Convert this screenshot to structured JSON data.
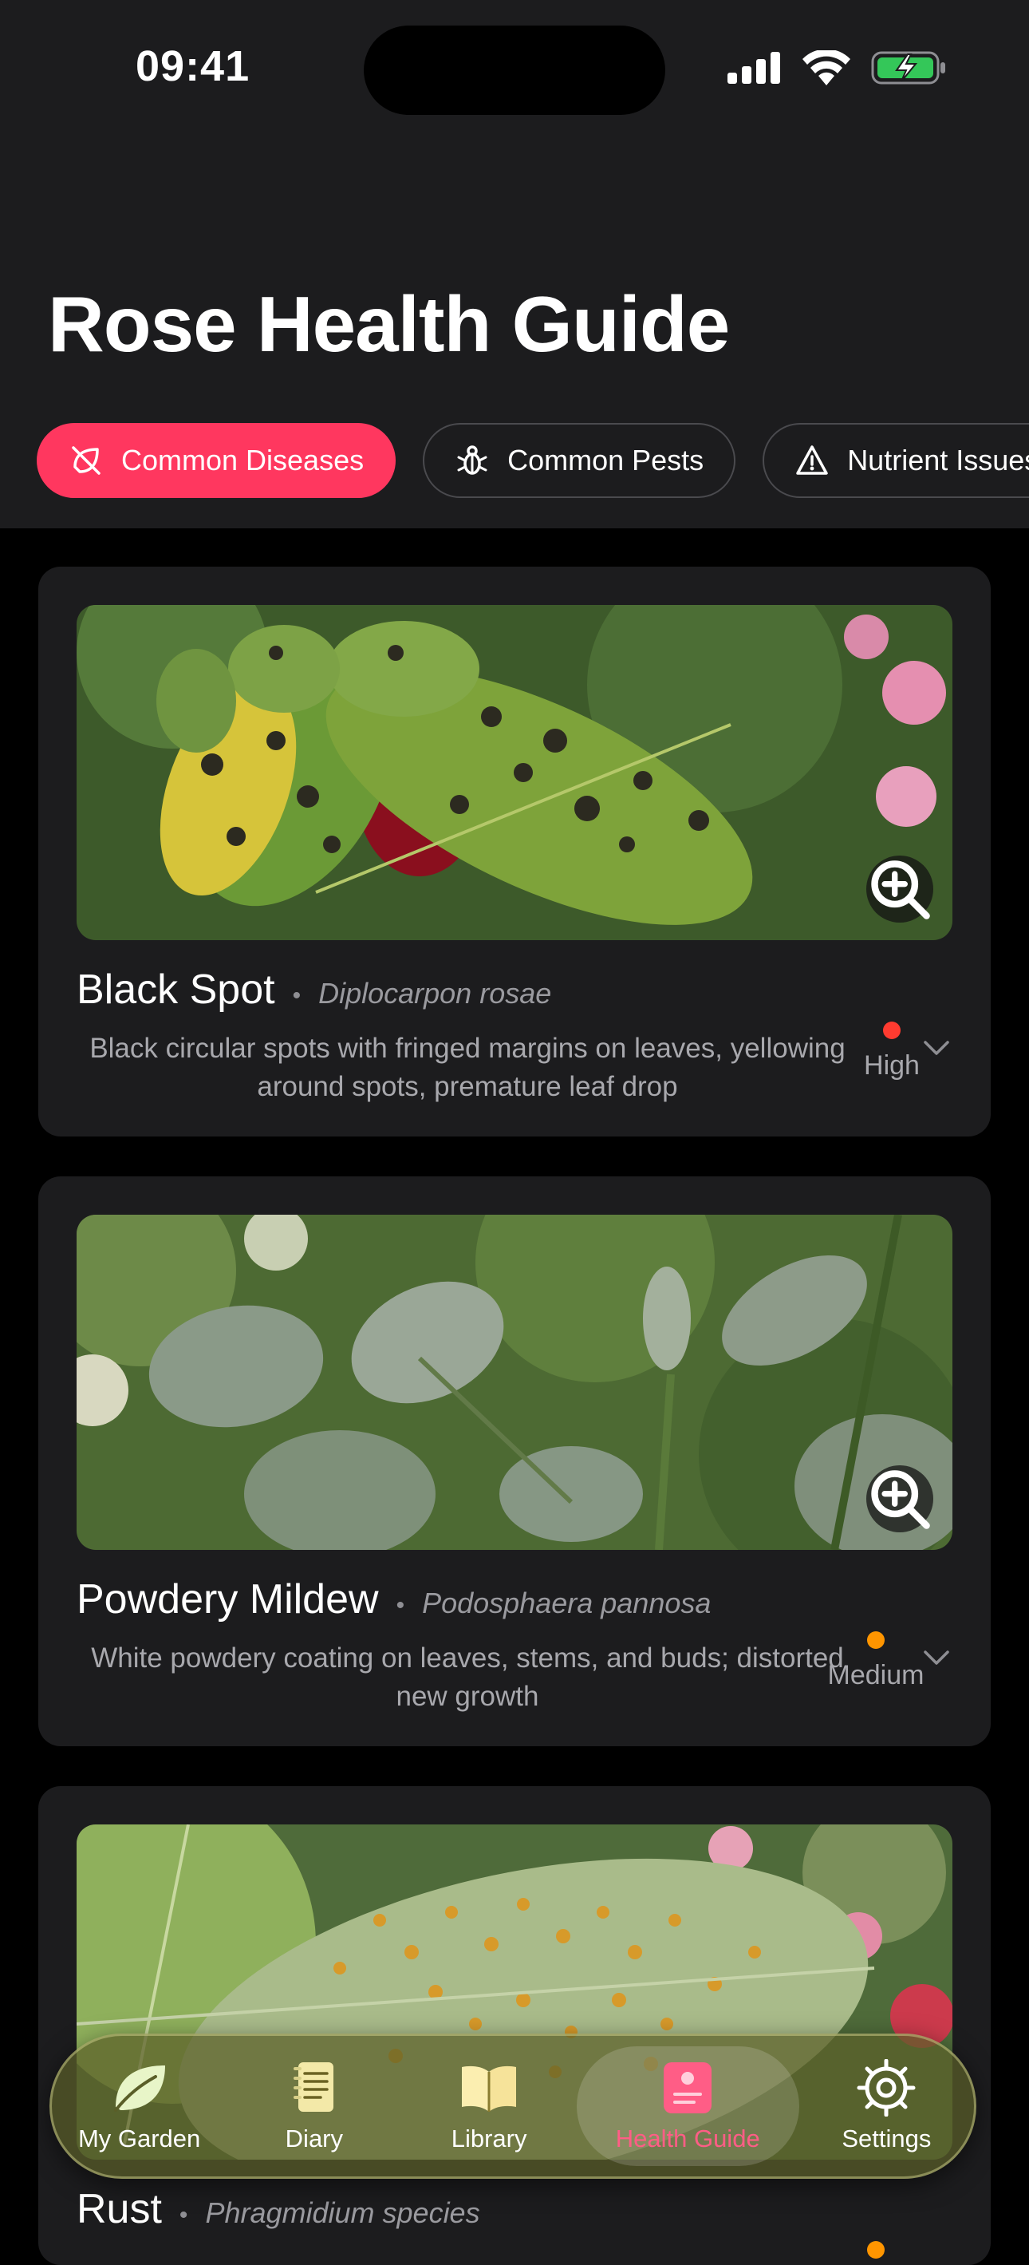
{
  "status_bar": {
    "time": "09:41"
  },
  "page": {
    "title": "Rose Health Guide"
  },
  "tabs": [
    {
      "label": "Common Diseases",
      "icon": "leaf-slash-icon",
      "active": true
    },
    {
      "label": "Common Pests",
      "icon": "bug-icon",
      "active": false
    },
    {
      "label": "Nutrient Issues",
      "icon": "warning-icon",
      "active": false
    }
  ],
  "cards": [
    {
      "name": "Black Spot",
      "latin": "Diplocarpon rosae",
      "description": "Black circular spots with fringed margins on leaves, yellowing around spots, premature leaf drop",
      "severity": "High",
      "severity_color": "#ff3b30"
    },
    {
      "name": "Powdery Mildew",
      "latin": "Podosphaera pannosa",
      "description": "White powdery coating on leaves, stems, and buds; distorted new growth",
      "severity": "Medium",
      "severity_color": "#ff9500"
    },
    {
      "name": "Rust",
      "latin": "Phragmidium species",
      "severity_color": "#ff9500"
    }
  ],
  "tab_bar": [
    {
      "label": "My Garden",
      "icon": "leaf-icon",
      "active": false
    },
    {
      "label": "Diary",
      "icon": "notebook-icon",
      "active": false
    },
    {
      "label": "Library",
      "icon": "open-book-icon",
      "active": false
    },
    {
      "label": "Health Guide",
      "icon": "health-report-icon",
      "active": true
    },
    {
      "label": "Settings",
      "icon": "gear-icon",
      "active": false
    }
  ],
  "colors": {
    "accent": "#ff375f",
    "background": "#000000",
    "card": "#1c1c1e"
  }
}
